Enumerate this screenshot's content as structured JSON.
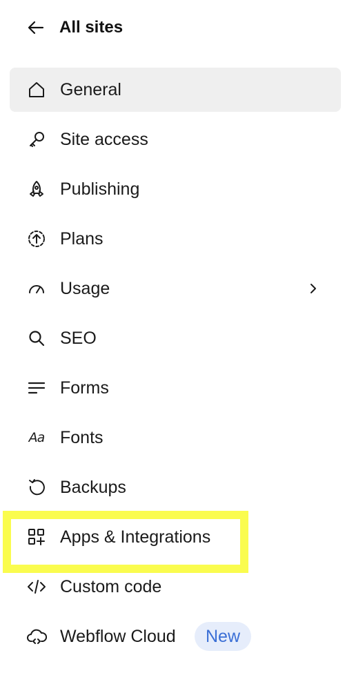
{
  "header": {
    "back_icon": "arrow-left-icon",
    "title": "All sites"
  },
  "nav": {
    "items": [
      {
        "label": "General",
        "icon": "home-icon",
        "active": true
      },
      {
        "label": "Site access",
        "icon": "key-icon"
      },
      {
        "label": "Publishing",
        "icon": "rocket-icon"
      },
      {
        "label": "Plans",
        "icon": "plan-upgrade-icon"
      },
      {
        "label": "Usage",
        "icon": "gauge-icon",
        "chevron": "chevron-right-icon"
      },
      {
        "label": "SEO",
        "icon": "search-icon"
      },
      {
        "label": "Forms",
        "icon": "form-lines-icon"
      },
      {
        "label": "Fonts",
        "icon": "font-icon",
        "icon_text": "Aa"
      },
      {
        "label": "Backups",
        "icon": "restore-icon"
      },
      {
        "label": "Apps & Integrations",
        "icon": "apps-grid-icon",
        "highlighted": true
      },
      {
        "label": "Custom code",
        "icon": "code-icon"
      },
      {
        "label": "Webflow Cloud",
        "icon": "cloud-code-icon",
        "badge": "New"
      }
    ]
  },
  "colors": {
    "active_bg": "#efefef",
    "highlight": "#fafc4e",
    "badge_bg": "#e6edfb",
    "badge_text": "#3b6fd6"
  }
}
